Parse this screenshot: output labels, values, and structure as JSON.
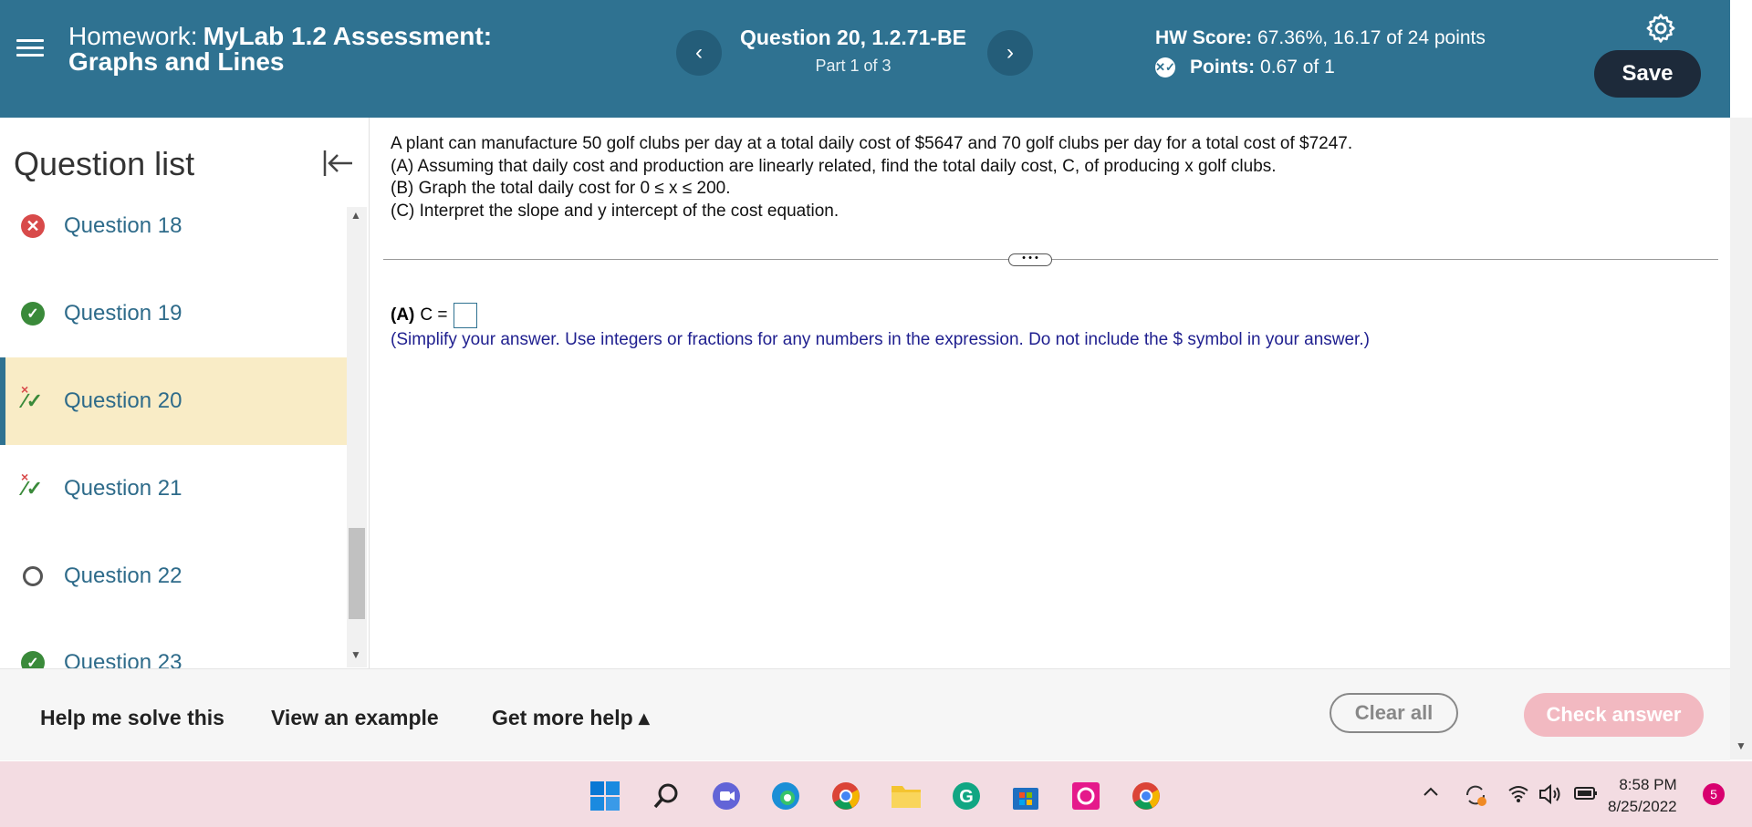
{
  "header": {
    "hw_prefix": "Homework:",
    "hw_title_line1": "MyLab 1.2 Assessment:",
    "hw_title_line2": "Graphs and Lines",
    "question_title": "Question 20, 1.2.71-BE",
    "question_part": "Part 1 of 3",
    "prev_icon": "‹",
    "next_icon": "›",
    "hw_score_label": "HW Score:",
    "hw_score_value": "67.36%, 16.17 of 24 points",
    "points_label": "Points:",
    "points_value": "0.67 of 1",
    "save_label": "Save"
  },
  "sidebar": {
    "title": "Question list",
    "items": [
      {
        "label": "Question 18",
        "status": "wrong"
      },
      {
        "label": "Question 19",
        "status": "correct"
      },
      {
        "label": "Question 20",
        "status": "partial"
      },
      {
        "label": "Question 21",
        "status": "partial"
      },
      {
        "label": "Question 22",
        "status": "unanswered"
      },
      {
        "label": "Question 23",
        "status": "correct"
      }
    ]
  },
  "problem": {
    "line1": "A plant can manufacture 50 golf clubs per day at a total daily cost of $5647 and 70 golf clubs  per day for a total cost of $7247.",
    "line2": "(A) Assuming that daily cost and production are linearly related, find the total daily cost, C, of producing x golf clubs.",
    "line3": "(B) Graph the total daily cost for 0 ≤ x ≤ 200.",
    "line4": "(C) Interpret the slope and y intercept of the cost equation.",
    "answer_part_label": "(A)",
    "answer_var": "C =",
    "hint": "(Simplify your answer. Use integers or fractions for any numbers in the expression. Do not include the $ symbol in your answer.)"
  },
  "toolbar": {
    "help_solve": "Help me solve this",
    "view_example": "View an example",
    "more_help": "Get more help ▴",
    "clear_all": "Clear all",
    "check_answer": "Check answer"
  },
  "taskbar": {
    "time": "8:58 PM",
    "date": "8/25/2022",
    "notification_count": "5"
  },
  "colors": {
    "header_bg": "#2f7291",
    "active_question_bg": "#f9ecc6",
    "check_answer_bg": "#f2b9c1"
  }
}
